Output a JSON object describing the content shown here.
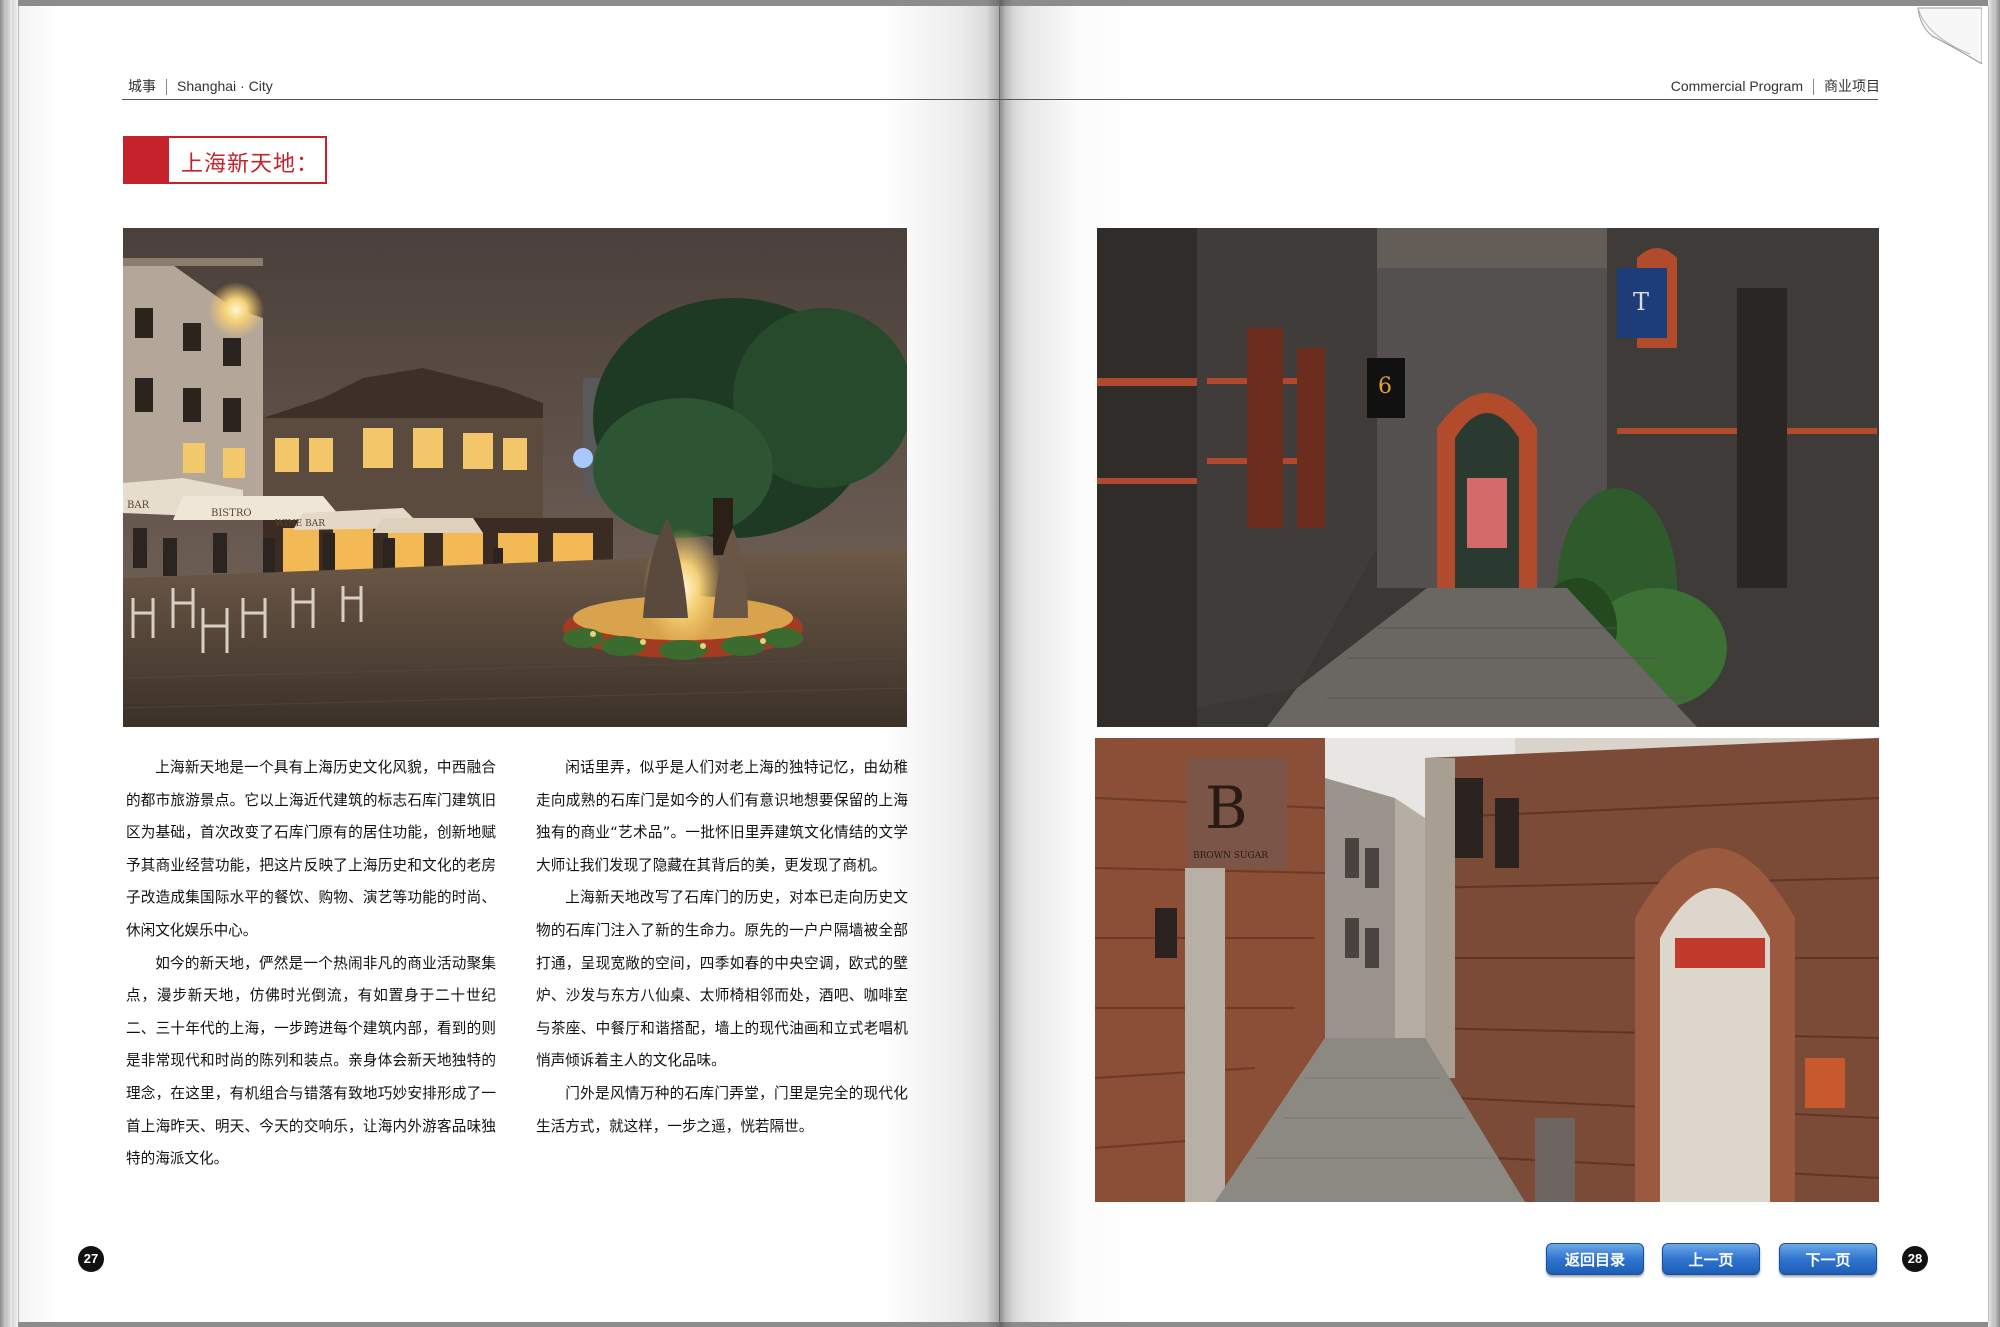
{
  "header": {
    "left_cn": "城事",
    "left_en": "Shanghai · City",
    "right_en": "Commercial Program",
    "right_cn": "商业项目"
  },
  "section_title": "上海新天地：",
  "article": {
    "col1": [
      "上海新天地是一个具有上海历史文化风貌，中西融合的都市旅游景点。它以上海近代建筑的标志石库门建筑旧区为基础，首次改变了石库门原有的居住功能，创新地赋予其商业经营功能，把这片反映了上海历史和文化的老房子改造成集国际水平的餐饮、购物、演艺等功能的时尚、休闲文化娱乐中心。",
      "如今的新天地，俨然是一个热闹非凡的商业活动聚集点，漫步新天地，仿佛时光倒流，有如置身于二十世纪二、三十年代的上海，一步跨进每个建筑内部，看到的则是非常现代和时尚的陈列和装点。亲身体会新天地独特的理念，在这里，有机组合与错落有致地巧妙安排形成了一首上海昨天、明天、今天的交响乐，让海内外游客品味独特的海派文化。"
    ],
    "col2": [
      "闲话里弄，似乎是人们对老上海的独特记忆，由幼稚走向成熟的石库门是如今的人们有意识地想要保留的上海独有的商业“艺术品”。一批怀旧里弄建筑文化情结的文学大师让我们发现了隐藏在其背后的美，更发现了商机。",
      "上海新天地改写了石库门的历史，对本已走向历史文物的石库门注入了新的生命力。原先的一户户隔墙被全部打通，呈现宽敞的空间，四季如春的中央空调，欧式的壁炉、沙发与东方八仙桌、太师椅相邻而处，酒吧、咖啡室与茶座、中餐厅和谐搭配，墙上的现代油画和立式老唱机悄声倾诉着主人的文化品味。",
      "门外是风情万种的石库门弄堂，门里是完全的现代化生活方式，就这样，一步之遥，恍若隔世。"
    ]
  },
  "photos": {
    "plaza_signs": [
      "BISTRO",
      "BAR",
      "WINE BAR"
    ],
    "lane2_sign": "BROWN SUGAR"
  },
  "page_numbers": {
    "left": "27",
    "right": "28"
  },
  "nav": {
    "toc": "返回目录",
    "prev": "上一页",
    "next": "下一页"
  }
}
